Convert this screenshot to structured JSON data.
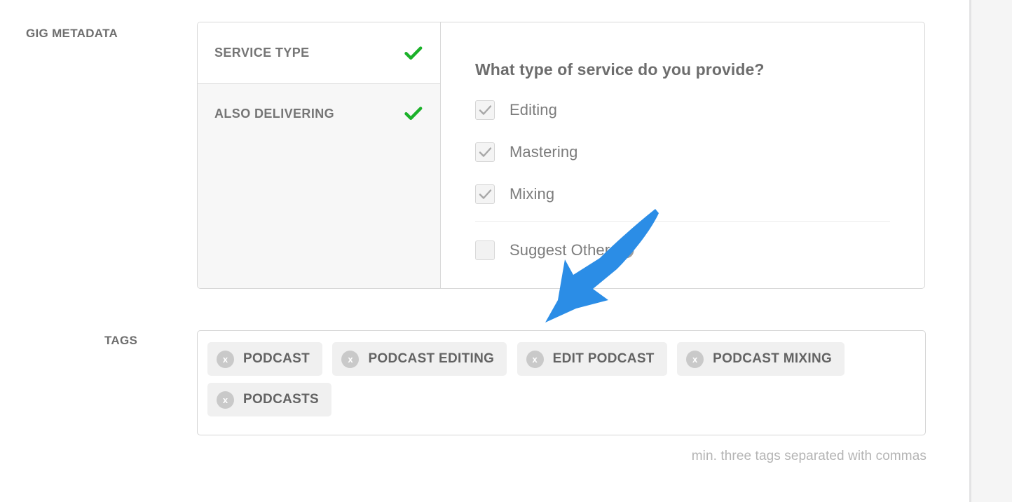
{
  "sections": {
    "gig_metadata_label": "GIG METADATA",
    "tags_label": "TAGS"
  },
  "metadata_panel": {
    "nav_items": [
      {
        "label": "SERVICE TYPE",
        "status_icon": "green-check",
        "selected": true
      },
      {
        "label": "ALSO DELIVERING",
        "status_icon": "green-check",
        "selected": false
      }
    ],
    "question": "What type of service do you provide?",
    "options": [
      {
        "label": "Editing",
        "checked": true,
        "disabled": true
      },
      {
        "label": "Mastering",
        "checked": true,
        "disabled": true
      },
      {
        "label": "Mixing",
        "checked": true,
        "disabled": true
      }
    ],
    "suggest_other": {
      "label": "Suggest Other",
      "checked": false,
      "help_icon": "question-mark-circle-icon"
    }
  },
  "tags": {
    "chips": [
      {
        "label": "PODCAST",
        "remove_icon": "x"
      },
      {
        "label": "PODCAST EDITING",
        "remove_icon": "x"
      },
      {
        "label": "EDIT PODCAST",
        "remove_icon": "x"
      },
      {
        "label": "PODCAST MIXING",
        "remove_icon": "x"
      },
      {
        "label": "PODCASTS",
        "remove_icon": "x"
      }
    ],
    "hint": "min. three tags separated with commas"
  },
  "annotation": {
    "arrow_icon": "blue-arrow-pointing-down-left",
    "color": "#2b8de6"
  },
  "colors": {
    "check_green": "#1bb12a",
    "label_gray": "#6e6e6e",
    "panel_border": "#d8d8d8",
    "chip_bg": "#f0f0f0",
    "hint_gray": "#b4b4b4"
  }
}
